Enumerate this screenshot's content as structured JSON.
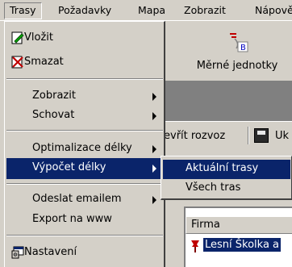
{
  "menubar": {
    "items": [
      {
        "label": "Trasy"
      },
      {
        "label": "Požadavky"
      },
      {
        "label": "Mapa"
      },
      {
        "label": "Zobrazit"
      },
      {
        "label": "Nápově"
      }
    ]
  },
  "background": {
    "toolbar_button_label": "Měrné jednotky",
    "toolbar2_left_label": "evřít rozvoz",
    "toolbar2_right_label": "Uk",
    "list_header": "Firma",
    "list_row": "Lesní Školka a"
  },
  "menu": {
    "items": [
      {
        "label": "Vložit",
        "icon": "pencil-doc-icon"
      },
      {
        "label": "Smazat",
        "icon": "delete-doc-icon"
      },
      {
        "label": "Zobrazit"
      },
      {
        "label": "Schovat"
      },
      {
        "label": "Optimalizace délky"
      },
      {
        "label": "Výpočet délky"
      },
      {
        "label": "Odeslat emailem"
      },
      {
        "label": "Export na www"
      },
      {
        "label": "Nastavení",
        "icon": "settings-window-icon"
      }
    ]
  },
  "submenu": {
    "items": [
      {
        "label": "Aktuální trasy"
      },
      {
        "label": "Všech tras"
      }
    ]
  },
  "colors": {
    "highlight": "#0a246a",
    "face": "#d4d0c8"
  }
}
